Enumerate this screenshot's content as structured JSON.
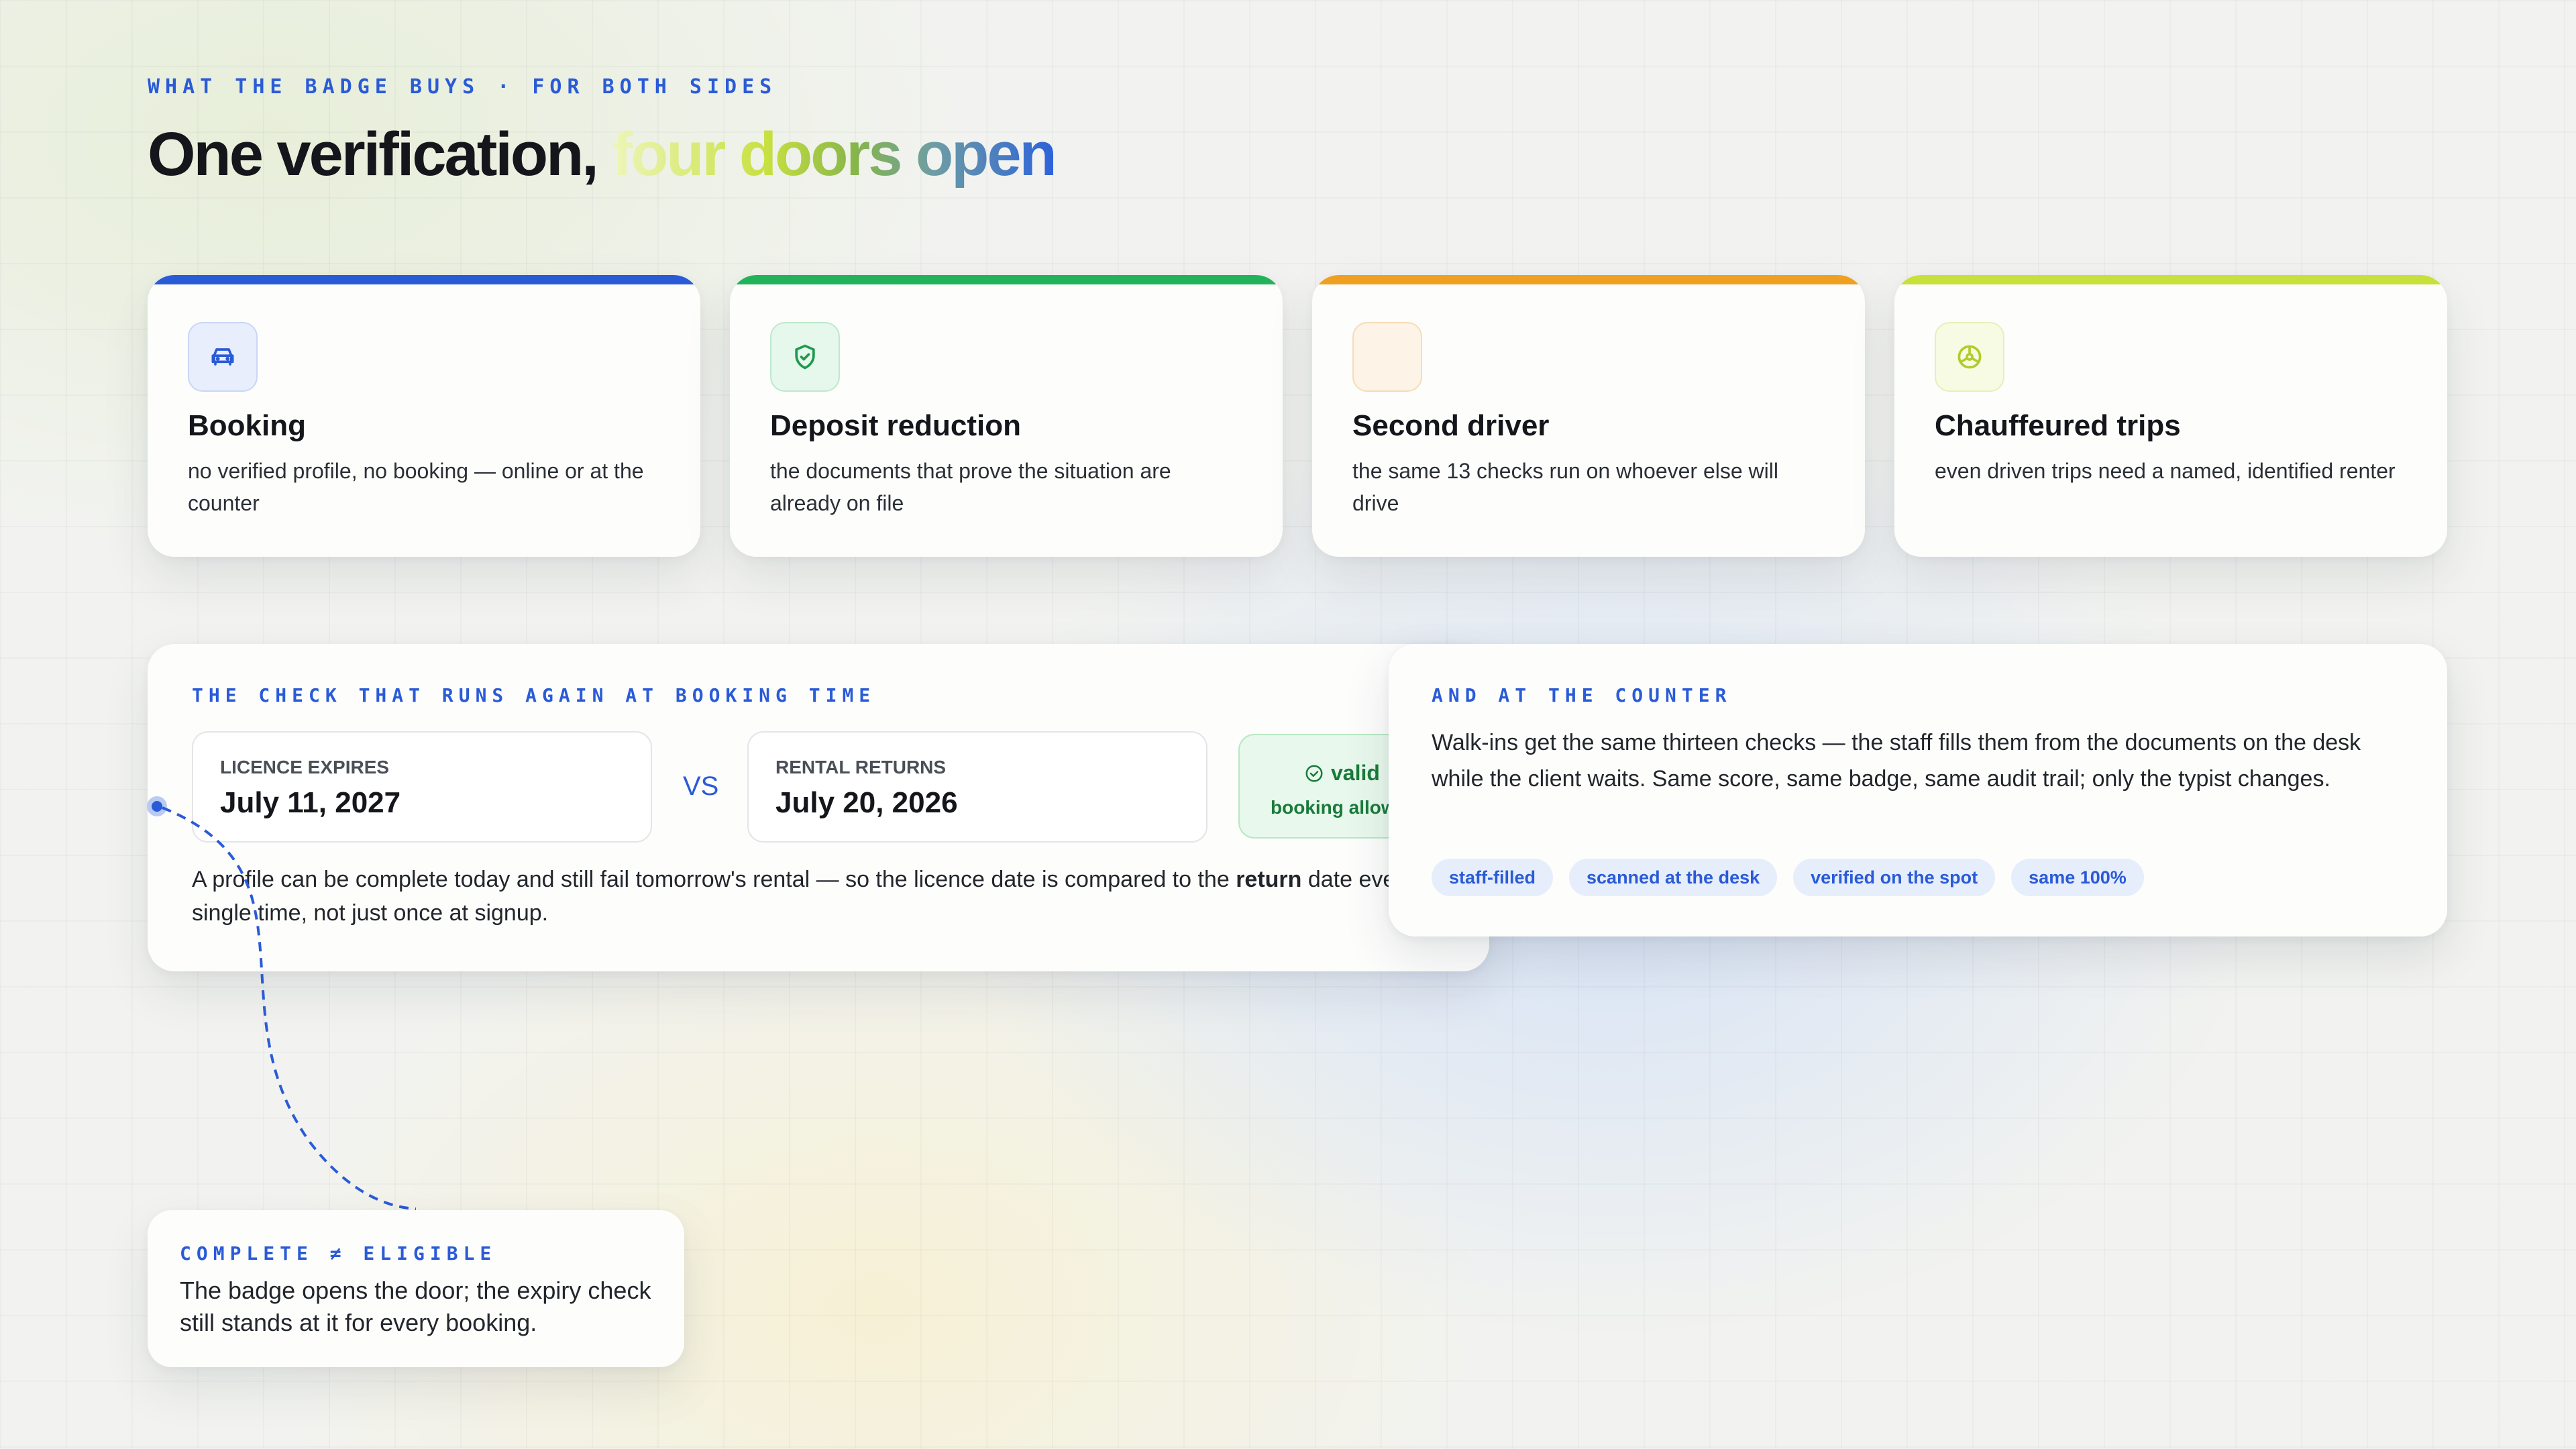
{
  "header": {
    "eyebrow": "WHAT THE BADGE BUYS · FOR BOTH SIDES",
    "title_main": "One verification, ",
    "title_accent": "four doors open"
  },
  "cards": [
    {
      "icon": "car-icon",
      "title": "Booking",
      "description": "no verified profile, no booking — online or at the counter",
      "accent": "#2a5bd7"
    },
    {
      "icon": "shield-check-icon",
      "title": "Deposit reduction",
      "description": "the documents that prove the situation are already on file",
      "accent": "#22b35a"
    },
    {
      "icon": "blank-icon",
      "title": "Second driver",
      "description": "the same 13 checks run on whoever else will drive",
      "accent": "#f0a020"
    },
    {
      "icon": "steering-wheel-icon",
      "title": "Chauffeured trips",
      "description": "even driven trips need a named, identified renter",
      "accent": "#c7e03a"
    }
  ],
  "booking_check": {
    "label": "THE CHECK THAT RUNS AGAIN AT BOOKING TIME",
    "licence_label": "LICENCE EXPIRES",
    "licence_date": "July 11, 2027",
    "vs": "VS",
    "rental_label": "RENTAL RETURNS",
    "rental_date": "July 20, 2026",
    "status": "valid",
    "status_sub": "booking allowed",
    "body_before": "A profile can be complete today and still fail tomorrow's rental — so the licence date is compared to the ",
    "body_bold": "return",
    "body_after": " date every single time, not just once at signup."
  },
  "counter": {
    "label": "AND AT THE COUNTER",
    "body": "Walk-ins get the same thirteen checks — the staff fills them from the documents on the desk while the client waits. Same score, same badge, same audit trail; only the typist changes.",
    "tags": [
      "staff-filled",
      "scanned at the desk",
      "verified on the spot",
      "same 100%"
    ]
  },
  "note": {
    "label": "COMPLETE ≠ ELIGIBLE",
    "body": "The badge opens the door; the expiry check still stands at it for every booking."
  },
  "colors": {
    "accent_blue": "#2a5bd7",
    "valid_green": "#1a7a3a"
  }
}
